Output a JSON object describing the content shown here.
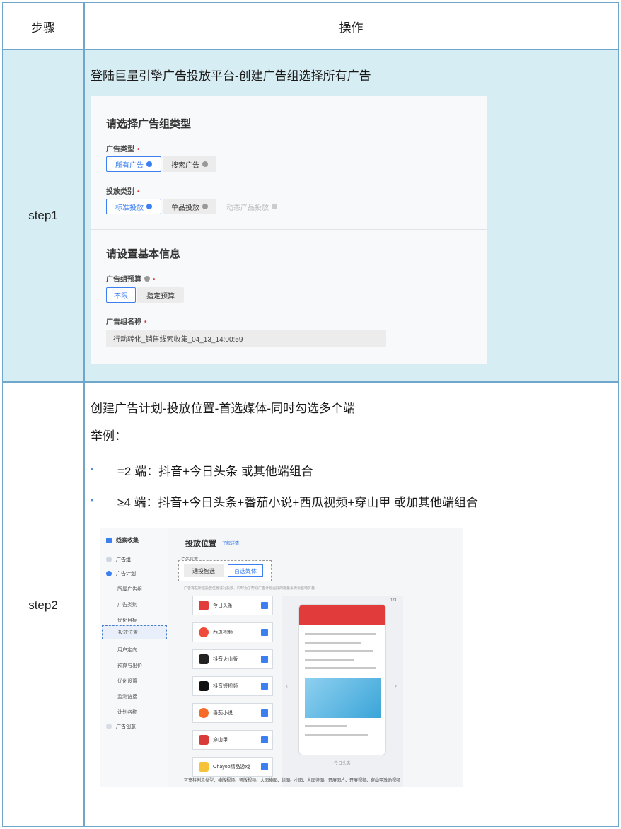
{
  "table": {
    "header_step": "步骤",
    "header_op": "操作",
    "rows": [
      {
        "step": "step1",
        "instruction": "登陆巨量引擎广告投放平台-创建广告组选择所有广告"
      },
      {
        "step": "step2",
        "instruction": "创建广告计划-投放位置-首选媒体-同时勾选多个端"
      }
    ],
    "example_label": "举例：",
    "bullets": [
      "=2 端：抖音+今日头条  或其他端组合",
      "≥4 端：抖音+今日头条+番茄小说+西瓜视频+穿山甲  或加其他端组合"
    ]
  },
  "shot1": {
    "section1_title": "请选择广告组类型",
    "ad_type_label": "广告类型",
    "ad_type_options": [
      "所有广告",
      "搜索广告"
    ],
    "delivery_label": "投放类别",
    "delivery_options": [
      "标准投放",
      "单品投放",
      "动态产品投放"
    ],
    "section2_title": "请设置基本信息",
    "budget_label": "广告组预算",
    "budget_options": [
      "不限",
      "指定预算"
    ],
    "name_label": "广告组名称",
    "name_value": "行动转化_销售线索收集_04_13_14:00:59"
  },
  "shot2": {
    "sidebar_title": "线索收集",
    "sidebar_items": [
      "广告组",
      "广告计划",
      "所属广告组",
      "广告类别",
      "优化目标",
      "投放位置",
      "用户定向",
      "预算与出价",
      "优化设置",
      "监测链接",
      "计划名称",
      "广告创意"
    ],
    "title": "投放位置",
    "link": "了解详情",
    "position_label": "广告位置",
    "position_options": [
      "通投智选",
      "首选媒体"
    ],
    "hint": "广告将在所选投放位置进行投放，同时为了帮助广告计划更好的跑量系统会自动扩量",
    "media": [
      "今日头条",
      "西瓜视频",
      "抖音火山版",
      "抖音短视频",
      "番茄小说",
      "穿山甲",
      "Ohayoo精品游戏"
    ],
    "phone_caption": "今日头条",
    "page_indicator": "1/3",
    "bottom_note": "可支持创意类型：横版视频、竖版视频、大图横图、组图、小图、大图竖图、开屏图片、开屏视频、穿山甲激励视频",
    "colors": {
      "accent": "#3b7ff0",
      "toutiao": "#e23b3b"
    }
  },
  "colors": {
    "border": "#6ea7c9",
    "row_highlight": "#d6edf3"
  }
}
